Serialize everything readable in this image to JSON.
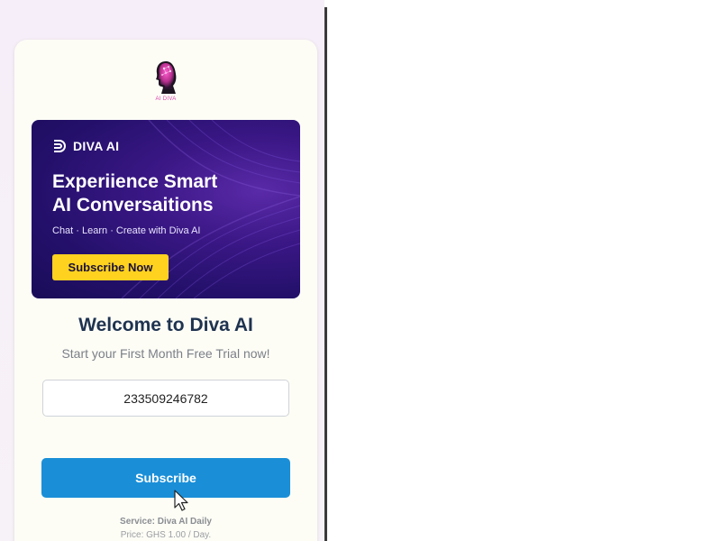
{
  "logo": {
    "text": "AI DIVA",
    "icon": "ai-head-icon"
  },
  "banner": {
    "brand": "DIVA AI",
    "brand_icon": "diva-d-logo-icon",
    "headline_line1": "Experiience Smart",
    "headline_line2": "AI Conversaitions",
    "tagline": "Chat · Learn · Create with Diva AI",
    "cta_label": "Subscribe Now"
  },
  "welcome": {
    "title": "Welcome to Diva AI",
    "subtitle": "Start your First Month Free Trial now!"
  },
  "form": {
    "phone_value": "233509246782",
    "submit_label": "Subscribe"
  },
  "footer": {
    "service": "Service: Diva AI Daily",
    "price": "Price: GHS 1.00 / Day."
  },
  "colors": {
    "primary_button": "#1a8fd8",
    "banner_cta": "#ffd21f",
    "banner_background": "#23106a",
    "heading": "#1f3350"
  }
}
